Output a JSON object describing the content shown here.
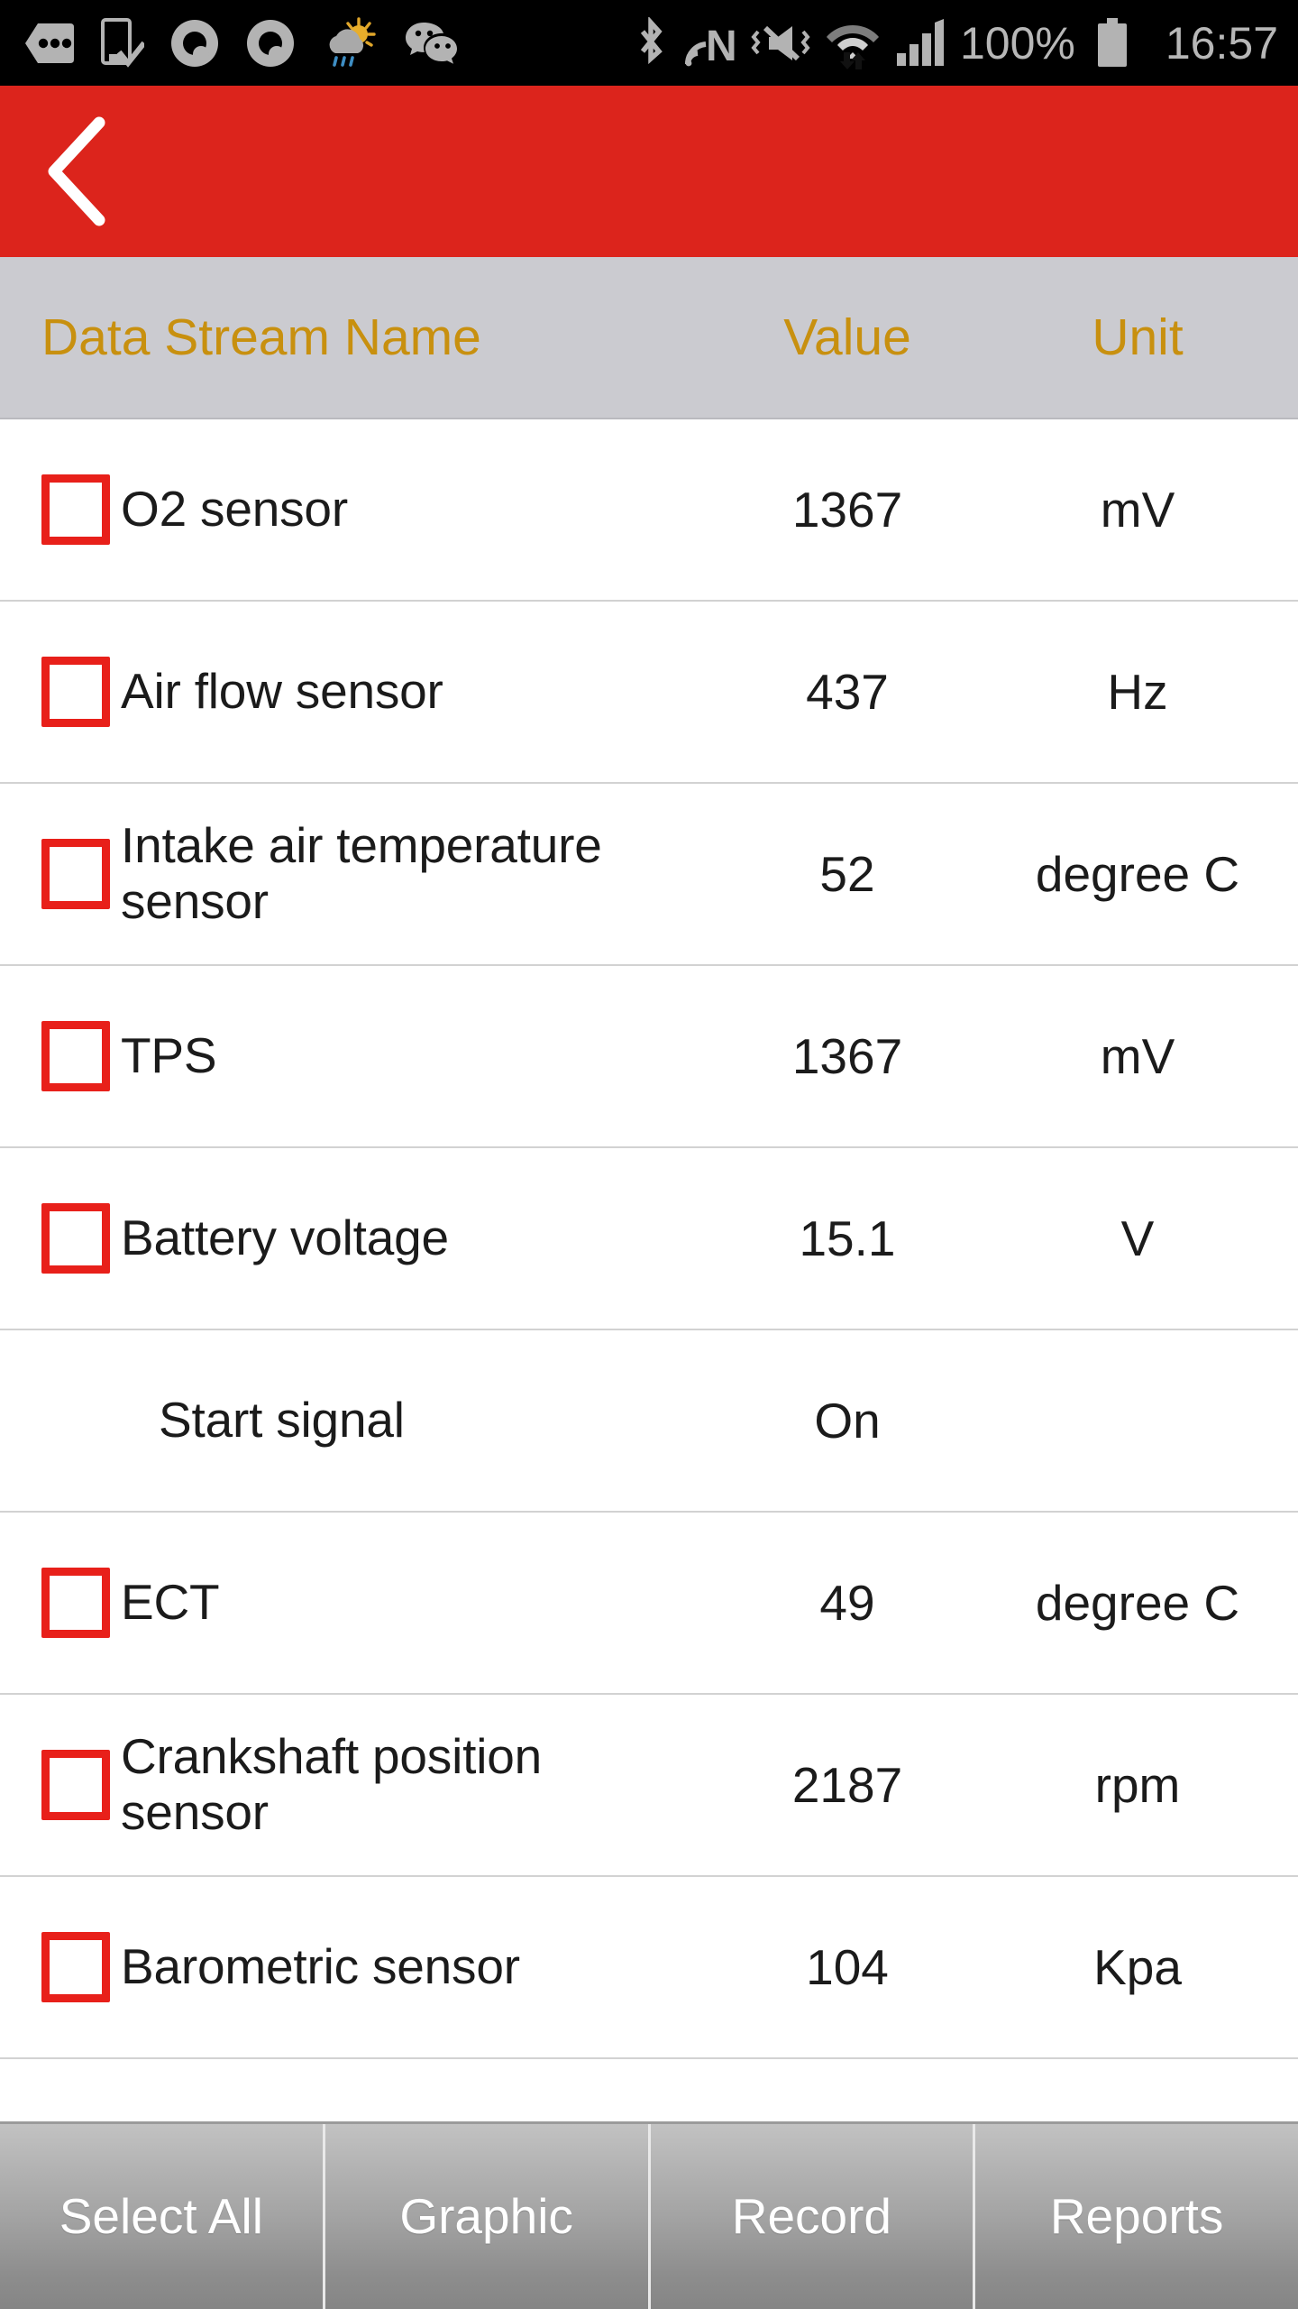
{
  "statusbar": {
    "battery_percent": "100%",
    "time": "16:57",
    "icons_left": [
      "more-options-tag-icon",
      "phone-download-check-icon",
      "cloud-q-app-icon",
      "cloud-q-app-icon-2",
      "weather-sun-cloud-rain-icon",
      "wechat-icon"
    ],
    "icons_right": [
      "bluetooth-icon",
      "nfc-icon",
      "vibrate-mute-icon",
      "wifi-data-transfer-icon",
      "cellular-signal-icon"
    ]
  },
  "appbar": {
    "back_label": "Back",
    "bg_color": "#dc241c"
  },
  "table": {
    "columns": {
      "name": "Data Stream Name",
      "value": "Value",
      "unit": "Unit"
    },
    "header_bg": "#cbcbd0",
    "header_text_color": "#c8900f",
    "checkbox_color": "#e8201a",
    "rows": [
      {
        "name": "O2 sensor",
        "value": "1367",
        "unit": "mV",
        "checkbox": true,
        "checked": false
      },
      {
        "name": "Air flow sensor",
        "value": "437",
        "unit": "Hz",
        "checkbox": true,
        "checked": false
      },
      {
        "name": "Intake air temperature sensor",
        "value": "52",
        "unit": "degree C",
        "checkbox": true,
        "checked": false
      },
      {
        "name": "TPS",
        "value": "1367",
        "unit": "mV",
        "checkbox": true,
        "checked": false
      },
      {
        "name": "Battery voltage",
        "value": "15.1",
        "unit": "V",
        "checkbox": true,
        "checked": false
      },
      {
        "name": "Start signal",
        "value": "On",
        "unit": "",
        "checkbox": false,
        "checked": false
      },
      {
        "name": "ECT",
        "value": "49",
        "unit": "degree C",
        "checkbox": true,
        "checked": false
      },
      {
        "name": "Crankshaft position sensor",
        "value": "2187",
        "unit": "rpm",
        "checkbox": true,
        "checked": false
      },
      {
        "name": "Barometric sensor",
        "value": "104",
        "unit": "Kpa",
        "checkbox": true,
        "checked": false
      }
    ]
  },
  "bottombar": {
    "buttons": [
      {
        "label": "Select All",
        "name": "select-all-button"
      },
      {
        "label": "Graphic",
        "name": "graphic-button"
      },
      {
        "label": "Record",
        "name": "record-button"
      },
      {
        "label": "Reports",
        "name": "reports-button"
      }
    ]
  }
}
